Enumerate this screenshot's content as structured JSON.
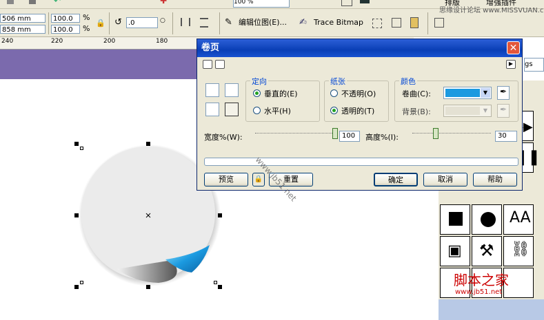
{
  "toolbar": {
    "zoom_value": "100 %",
    "x_value": "506 mm",
    "y_value": "858 mm",
    "scale_w": "100.0",
    "scale_h": "100.0",
    "percent": "%",
    "rotate_value": ".0",
    "edit_bitmap_label": "编辑位图(E)...",
    "trace_bitmap_label": "Trace Bitmap",
    "menu_arrange": "排版",
    "menu_plugin": "增强插件",
    "watermark": "思缘设计论坛 www.MISSVUAN.com"
  },
  "ruler": {
    "ticks": [
      "240",
      "220",
      "200",
      "180"
    ]
  },
  "dialog": {
    "title": "卷页",
    "close": "✕",
    "orientation": {
      "title": "定向",
      "vertical": "垂直的(E)",
      "horizontal": "水平(H)"
    },
    "paper": {
      "title": "纸张",
      "opaque": "不透明(O)",
      "transparent": "透明的(T)"
    },
    "color": {
      "title": "颜色",
      "curl_label": "卷曲(C):",
      "curl_color": "#1b9ae0",
      "background_label": "背景(B):",
      "background_color": "#e4e1d3"
    },
    "width_label": "宽度%(W):",
    "width_value": "100",
    "height_label": "高度%(I):",
    "height_value": "30",
    "buttons": {
      "preview": "预览",
      "reset": "重置",
      "ok": "确定",
      "cancel": "取消",
      "help": "帮助"
    },
    "watermark": "www.jb51.net"
  },
  "docker": {
    "partial_label": "gs"
  },
  "footer_watermark": {
    "logo": "脚本之家",
    "url": "www.jb51.net"
  }
}
